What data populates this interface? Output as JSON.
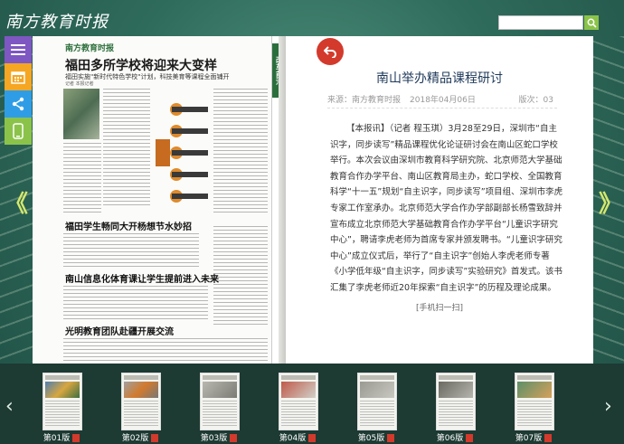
{
  "app": {
    "logo": "南方教育时报"
  },
  "search": {
    "placeholder": ""
  },
  "sidebar": {
    "items": [
      {
        "name": "menu"
      },
      {
        "name": "calendar"
      },
      {
        "name": "share"
      },
      {
        "name": "mobile"
      }
    ]
  },
  "nav": {
    "prev_label": "《",
    "next_label": "》"
  },
  "left_page": {
    "masthead": "南方教育时报",
    "headline": "福田多所学校将迎来大变样",
    "subhead": "福田实施\"新时代特色学校\"计划，科技美育等课程全面铺开",
    "byline": "记者 本报记者",
    "articles": [
      "福田学生畅同大开杨想节水妙招",
      "南山信息化体育课让学生提前进入未来",
      "光明教育团队赴疆开展交流"
    ],
    "side_tag": "改革前沿"
  },
  "article": {
    "title": "南山举办精品课程研讨",
    "source_label": "来源：南方教育时报",
    "date": "2018年04月06日",
    "issue": "版次：03",
    "body": "【本报讯】（记者 程玉琪）3月28至29日，深圳市“自主识字，同步读写”精品课程优化论证研讨会在南山区蛇口学校举行。本次会议由深圳市教育科学研究院、北京师范大学基础教育合作办学平台、南山区教育局主办，蛇口学校、全国教育科学“十一五”规划“自主识字，同步读写”项目组、深圳市李虎专家工作室承办。北京师范大学合作办学部副部长杨雪致辞并宣布成立北京师范大学基础教育合作办学平台“儿童识字研究中心”，聘请李虎老师为首席专家并颁发聘书。“儿童识字研究中心”成立仪式后，举行了“自主识字”创始人李虎老师专著《小学低年级“自主识字，同步读写”实验研究》首发式。该书汇集了李虎老师近20年探索“自主识字”的历程及理论成果。",
    "footer": "[手机扫一扫]"
  },
  "thumbnails": [
    {
      "label": "第01版"
    },
    {
      "label": "第02版"
    },
    {
      "label": "第03版"
    },
    {
      "label": "第04版"
    },
    {
      "label": "第05版"
    },
    {
      "label": "第06版"
    },
    {
      "label": "第07版"
    }
  ],
  "colors": {
    "accent_green": "#8bc34a",
    "sidebar_purple": "#7e57c2",
    "sidebar_orange": "#f5a623",
    "sidebar_blue": "#2f9de6",
    "back_red": "#d33a2c",
    "title_blue": "#1f3a5a"
  }
}
